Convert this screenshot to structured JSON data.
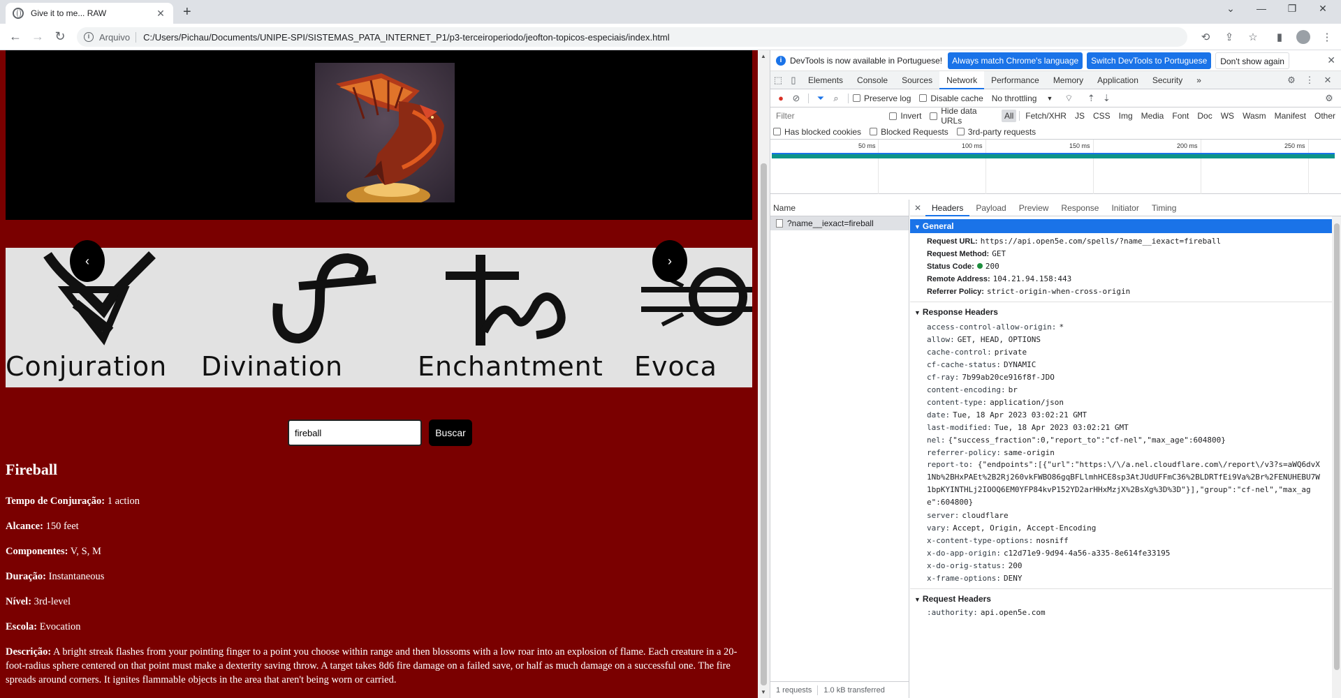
{
  "browser": {
    "tab_title": "Give it to me... RAW",
    "address_scheme": "Arquivo",
    "address_url": "C:/Users/Pichau/Documents/UNIPE-SPI/SISTEMAS_PATA_INTERNET_P1/p3-terceiroperiodo/jeofton-topicos-especiais/index.html"
  },
  "page": {
    "carousel": {
      "schools": [
        "Conjuration",
        "Divination",
        "Enchantment",
        "Evoca"
      ],
      "prev_label": "‹",
      "next_label": "›"
    },
    "search": {
      "value": "fireball",
      "button_label": "Buscar"
    },
    "spell": {
      "name": "Fireball",
      "rows": [
        {
          "label": "Tempo de Conjuração:",
          "value": "1 action"
        },
        {
          "label": "Alcance:",
          "value": "150 feet"
        },
        {
          "label": "Componentes:",
          "value": "V, S, M"
        },
        {
          "label": "Duração:",
          "value": "Instantaneous"
        },
        {
          "label": "Nível:",
          "value": "3rd-level"
        },
        {
          "label": "Escola:",
          "value": "Evocation"
        }
      ],
      "description_label": "Descrição:",
      "description": "A bright streak flashes from your pointing finger to a point you choose within range and then blossoms with a low roar into an explosion of flame. Each creature in a 20-foot-radius sphere centered on that point must make a dexterity saving throw. A target takes 8d6 fire damage on a failed save, or half as much damage on a successful one. The fire spreads around corners. It ignites flammable objects in the area that aren't being worn or carried."
    }
  },
  "devtools": {
    "infobar": {
      "message": "DevTools is now available in Portuguese!",
      "btn_match": "Always match Chrome's language",
      "btn_switch": "Switch DevTools to Portuguese",
      "btn_dont_show": "Don't show again"
    },
    "tabs": [
      "Elements",
      "Console",
      "Sources",
      "Network",
      "Performance",
      "Memory",
      "Application",
      "Security"
    ],
    "more_tabs": "»",
    "network_toolbar": {
      "preserve_log": "Preserve log",
      "disable_cache": "Disable cache",
      "throttling": "No throttling"
    },
    "filter": {
      "placeholder": "Filter",
      "invert": "Invert",
      "hide_data_urls": "Hide data URLs",
      "types": [
        "All",
        "Fetch/XHR",
        "JS",
        "CSS",
        "Img",
        "Media",
        "Font",
        "Doc",
        "WS",
        "Wasm",
        "Manifest",
        "Other"
      ],
      "blocked_cookies": "Has blocked cookies",
      "blocked_requests": "Blocked Requests",
      "third_party": "3rd-party requests"
    },
    "overview_ticks": [
      "50 ms",
      "100 ms",
      "150 ms",
      "200 ms",
      "250 ms"
    ],
    "name_header": "Name",
    "request_name": "?name__iexact=fireball",
    "status": {
      "requests": "1 requests",
      "transferred": "1.0 kB transferred"
    },
    "detail_tabs": [
      "Headers",
      "Payload",
      "Preview",
      "Response",
      "Initiator",
      "Timing"
    ],
    "general": {
      "title": "General",
      "items": [
        {
          "k": "Request URL:",
          "v": "https://api.open5e.com/spells/?name__iexact=fireball"
        },
        {
          "k": "Request Method:",
          "v": "GET"
        },
        {
          "k": "Status Code:",
          "v": "200"
        },
        {
          "k": "Remote Address:",
          "v": "104.21.94.158:443"
        },
        {
          "k": "Referrer Policy:",
          "v": "strict-origin-when-cross-origin"
        }
      ]
    },
    "response_headers": {
      "title": "Response Headers",
      "items": [
        {
          "k": "access-control-allow-origin:",
          "v": "*"
        },
        {
          "k": "allow:",
          "v": "GET, HEAD, OPTIONS"
        },
        {
          "k": "cache-control:",
          "v": "private"
        },
        {
          "k": "cf-cache-status:",
          "v": "DYNAMIC"
        },
        {
          "k": "cf-ray:",
          "v": "7b99ab20ce916f8f-JDO"
        },
        {
          "k": "content-encoding:",
          "v": "br"
        },
        {
          "k": "content-type:",
          "v": "application/json"
        },
        {
          "k": "date:",
          "v": "Tue, 18 Apr 2023 03:02:21 GMT"
        },
        {
          "k": "last-modified:",
          "v": "Tue, 18 Apr 2023 03:02:21 GMT"
        },
        {
          "k": "nel:",
          "v": "{\"success_fraction\":0,\"report_to\":\"cf-nel\",\"max_age\":604800}"
        },
        {
          "k": "referrer-policy:",
          "v": "same-origin"
        }
      ],
      "report_to_key": "report-to:",
      "report_to_value": "{\"endpoints\":[{\"url\":\"https:\\/\\/a.nel.cloudflare.com\\/report\\/v3?s=aWQ6dvX1Nb%2BHxPAEt%2B2Rj260vkFWBO86gqBFLlmhHCE8sp3AtJUdUFFmC36%2BLDRTfEi9Va%2Br%2FENUHEBU7W1bpKYINTHLj2IOOQ6EM0YFP84kvP152YD2arHHxMzjX%2BsXg%3D%3D\"}],\"group\":\"cf-nel\",\"max_age\":604800}",
      "items_after": [
        {
          "k": "server:",
          "v": "cloudflare"
        },
        {
          "k": "vary:",
          "v": "Accept, Origin, Accept-Encoding"
        },
        {
          "k": "x-content-type-options:",
          "v": "nosniff"
        },
        {
          "k": "x-do-app-origin:",
          "v": "c12d71e9-9d94-4a56-a335-8e614fe33195"
        },
        {
          "k": "x-do-orig-status:",
          "v": "200"
        },
        {
          "k": "x-frame-options:",
          "v": "DENY"
        }
      ]
    },
    "request_headers": {
      "title": "Request Headers",
      "items": [
        {
          "k": ":authority:",
          "v": "api.open5e.com"
        }
      ]
    }
  }
}
